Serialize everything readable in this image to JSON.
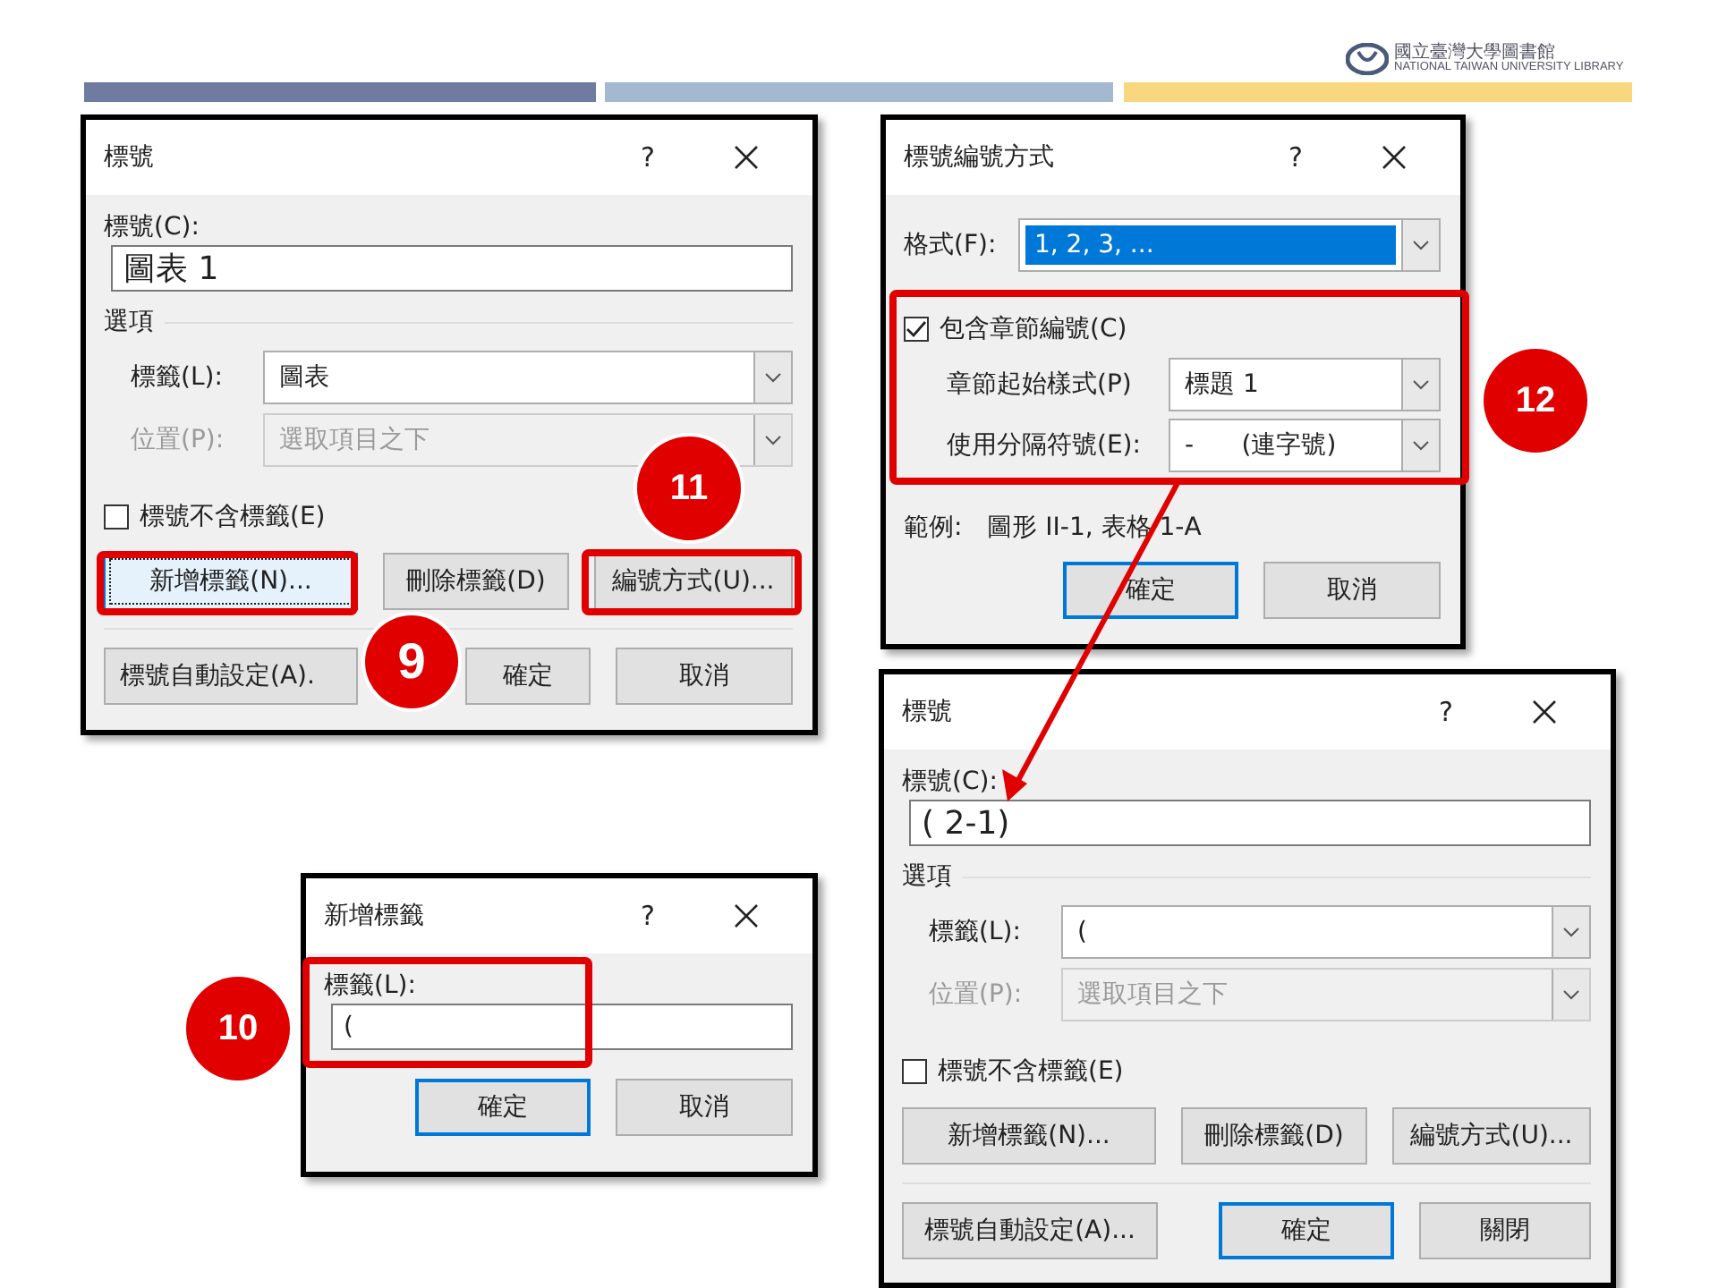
{
  "header": {
    "logo_text": "國立臺灣大學圖書館",
    "logo_subtitle": "NATIONAL TAIWAN UNIVERSITY LIBRARY"
  },
  "dialogs": [
    {
      "kind": "caption",
      "title": "標號",
      "help": "?",
      "caption_label": "標號(C):",
      "caption_value": "圖表 1",
      "options_heading": "選項",
      "fields": [
        {
          "label": "標籤(L):",
          "value": "圖表",
          "disabled": false
        },
        {
          "label": "位置(P):",
          "value": "選取項目之下",
          "disabled": true
        }
      ],
      "checkbox": {
        "label": "標號不含標籤(E)",
        "checked": false
      },
      "buttons": [
        [
          {
            "label": "新增標籤(N)...",
            "focused": true,
            "default": false
          },
          {
            "label": "刪除標籤(D)",
            "focused": false,
            "default": false
          },
          {
            "label": "編號方式(U)...",
            "focused": false,
            "default": false
          }
        ],
        [
          {
            "label": "標號自動設定(A).",
            "focused": false,
            "default": false
          },
          {
            "label": "確定",
            "focused": false,
            "default": false
          },
          {
            "label": "取消",
            "focused": false,
            "default": false
          }
        ]
      ]
    },
    {
      "kind": "numbering",
      "title": "標號編號方式",
      "help": "?",
      "format": {
        "label": "格式(F):",
        "value": "1, 2, 3, ...",
        "highlighted": true
      },
      "chapter": {
        "label": "包含章節編號(C)",
        "checked": true
      },
      "fields": [
        {
          "label": "章節起始樣式(P)",
          "value": "標題 1",
          "disabled": false
        },
        {
          "label": "使用分隔符號(E):",
          "value": "-      (連字號)",
          "disabled": false
        }
      ],
      "example_label": "範例:",
      "example_value": "圖形 II-1, 表格 1-A",
      "buttons": [
        [
          {
            "label": "確定",
            "focused": false,
            "default": true
          },
          {
            "label": "取消",
            "focused": false,
            "default": false
          }
        ]
      ]
    },
    {
      "kind": "new_label",
      "title": "新增標籤",
      "help": "?",
      "field_label": "標籤(L):",
      "field_value": "(",
      "buttons": [
        [
          {
            "label": "確定",
            "focused": false,
            "default": true
          },
          {
            "label": "取消",
            "focused": false,
            "default": false
          }
        ]
      ]
    },
    {
      "kind": "caption",
      "title": "標號",
      "help": "?",
      "caption_label": "標號(C):",
      "caption_value": "( 2-1)",
      "options_heading": "選項",
      "fields": [
        {
          "label": "標籤(L):",
          "value": "(",
          "disabled": false
        },
        {
          "label": "位置(P):",
          "value": "選取項目之下",
          "disabled": true
        }
      ],
      "checkbox": {
        "label": "標號不含標籤(E)",
        "checked": false
      },
      "buttons": [
        [
          {
            "label": "新增標籤(N)...",
            "focused": false,
            "default": false
          },
          {
            "label": "刪除標籤(D)",
            "focused": false,
            "default": false
          },
          {
            "label": "編號方式(U)...",
            "focused": false,
            "default": false
          }
        ],
        [
          {
            "label": "標號自動設定(A)...",
            "focused": false,
            "default": false
          },
          {
            "label": "確定",
            "focused": false,
            "default": true
          },
          {
            "label": "關閉",
            "focused": false,
            "default": false
          }
        ]
      ]
    }
  ],
  "badges": [
    "9",
    "10",
    "11",
    "12"
  ]
}
